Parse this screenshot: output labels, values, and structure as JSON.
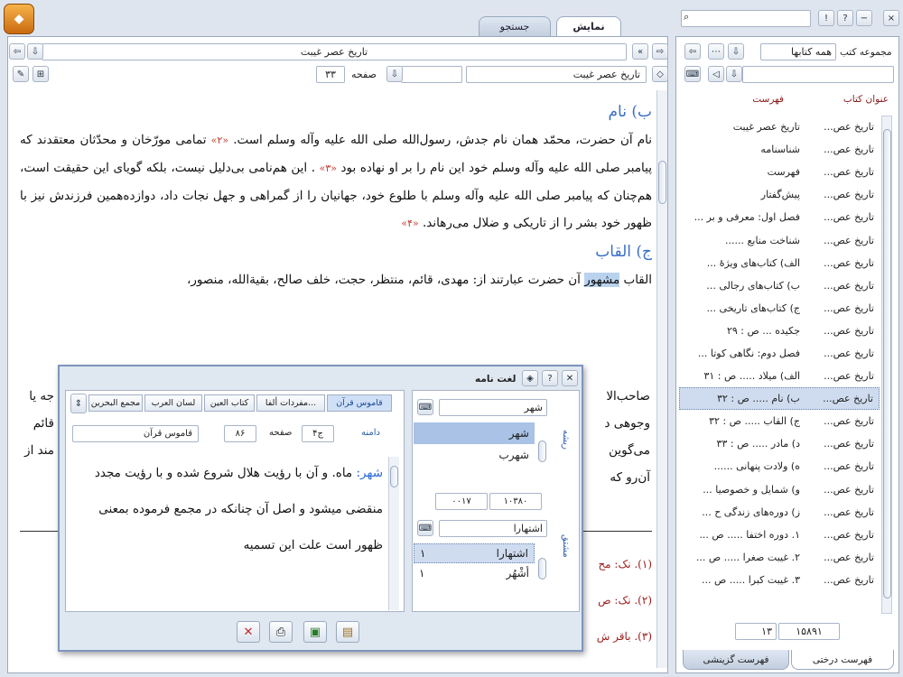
{
  "tabs": {
    "display": "نمایش",
    "search": "جستجو"
  },
  "window_controls": {
    "close": "×",
    "minimize": "−",
    "help": "?",
    "info": "!"
  },
  "top_search": {
    "placeholder": ""
  },
  "doc_toolbar": {
    "book_title": "تاریخ عصر غیبت",
    "book_select": "تاریخ عصر غیبت",
    "page_label": "صفحه",
    "page_value": "۳۳"
  },
  "document": {
    "heading_b": "ب) نام",
    "para_1": "نام آن حضرت، محمّد همان نام جدش، رسول‌الله صلی الله علیه وآله وسلم است.",
    "fn_2": "«۲»",
    "para_1b": "تمامی مورّخان و محدّثان معتقدند که پیامبر صلی الله علیه وآله وسلم خود این نام را بر او نهاده بود",
    "fn_3": "«۳»",
    "para_1c": ". این هم‌نامی بی‌دلیل نیست، بلکه گویای این حقیقت است، هم‌چنان که پیامبر صلی الله علیه وآله وسلم با طلوع خود، جهانیان را از گمراهی و جهل نجات داد، دوازده‌همین فرزندش نیز با ظهور خود بشر را از تاریکی و ضلال می‌رهاند.",
    "fn_4": "«۴»",
    "heading_j": "ج) القاب",
    "para_2a": "القاب ",
    "para_2_hl": "مشهور",
    "para_2b": " آن حضرت عبارتند از: مهدی، قائم، منتظر، حجت، خلف صالح، بقیة‌الله، منصور،",
    "para_2c": "صاحب‌الا",
    "para_2d": "جه یا",
    "para_3a": "وجوهی د",
    "para_3b": "قائم",
    "para_4a": "می‌گوین",
    "para_4b": "مند از",
    "para_5a": "آن‌رو که"
  },
  "footnotes": {
    "f1": "(۱). نک: مح",
    "f2": "(۲). نک: ص",
    "f3": "(۳). باقر ش"
  },
  "sidebar": {
    "collection_label": "مجموعه کتب",
    "collection_value": "همه کتابها",
    "col_book_title": "عنوان کتاب",
    "col_index": "فهرست",
    "rows": [
      {
        "book": "تاریخ عص...",
        "index": "تاریخ عصر غیبت"
      },
      {
        "book": "تاریخ عص...",
        "index": "شناسنامه"
      },
      {
        "book": "تاریخ عص...",
        "index": "فهرست"
      },
      {
        "book": "تاریخ عص...",
        "index": "پیش‌گفتار"
      },
      {
        "book": "تاریخ عص...",
        "index": "فصل اول: معرفی و بر ..."
      },
      {
        "book": "تاریخ عص...",
        "index": "شناخت منابع ......"
      },
      {
        "book": "تاریخ عص...",
        "index": "الف) کتاب‌های ویژهٔ ..."
      },
      {
        "book": "تاریخ عص...",
        "index": "ب) کتاب‌های رجالی ..."
      },
      {
        "book": "تاریخ عص...",
        "index": "ج) کتاب‌های تاریخی ..."
      },
      {
        "book": "تاریخ عص...",
        "index": "جکیده ... ص : ۲۹"
      },
      {
        "book": "تاریخ عص...",
        "index": "فصل دوم: نگاهی کوتا ..."
      },
      {
        "book": "تاریخ عص...",
        "index": "الف) میلاد ..... ص : ۳۱"
      },
      {
        "book": "تاریخ عص...",
        "index": "ب) نام ..... ص : ۳۲"
      },
      {
        "book": "تاریخ عص...",
        "index": "ج) القاب ..... ص : ۳۲"
      },
      {
        "book": "تاریخ عص...",
        "index": "د) مادر ..... ص : ۳۳"
      },
      {
        "book": "تاریخ عص...",
        "index": "ه) ولادت پنهانی ......"
      },
      {
        "book": "تاریخ عص...",
        "index": "و) شمایل و خصوصیا ..."
      },
      {
        "book": "تاریخ عص...",
        "index": "ز) دوره‌های زندگی ح ..."
      },
      {
        "book": "تاریخ عص...",
        "index": "۱. دوره اختفا ..... ص ..."
      },
      {
        "book": "تاریخ عص...",
        "index": "۲. غیبت صغرا ..... ص ..."
      },
      {
        "book": "تاریخ عص...",
        "index": "۳. غیبت کبرا ..... ص ..."
      }
    ],
    "counter_left": "۱۳",
    "counter_right": "۱۵۸۹۱",
    "tab_tree": "فهرست درختی",
    "tab_selective": "فهرست گزینشی"
  },
  "dictionary": {
    "title": "لغت نامه",
    "search_value": "شهر",
    "range_label": "دامنه",
    "page_label": "صفحه",
    "volume_value": "ج۴",
    "page_value": "۸۶",
    "source_value": "قاموس قرآن",
    "tabs": [
      "قاموس قرآن",
      "مفردات ألفا...",
      "کتاب العین",
      "لسان العرب",
      "مجمع البحرین"
    ],
    "roots": [
      "شهر",
      "شهرب"
    ],
    "root_side_label": "ریشه",
    "deriv_side_label": "مشتق",
    "id_left": "۰۰۱۷",
    "id_right": "۱۰۳۸۰",
    "deriv_input": "اشتهارا",
    "derivatives": [
      {
        "word": "اشتهارا",
        "n": "۱"
      },
      {
        "word": "أشْهُر",
        "n": "۱"
      }
    ],
    "meaning_word": "شهر:",
    "meaning_text": " ماه. و آن با رؤیت هلال شروع شده و با رؤیت مجدد منقضی میشود و اصل آن چنانکه در مجمع فرموده بمعنی ظهور است علت این تسمیه"
  }
}
